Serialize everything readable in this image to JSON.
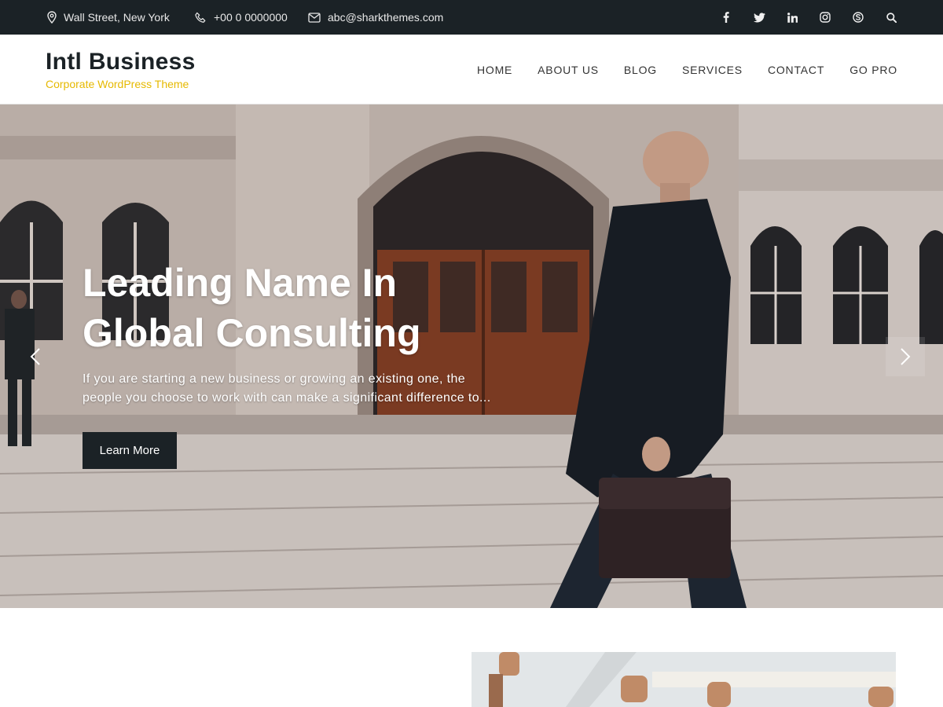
{
  "topbar": {
    "address": "Wall Street, New York",
    "phone": "+00 0 0000000",
    "email": "abc@sharkthemes.com",
    "social": [
      "facebook-icon",
      "twitter-icon",
      "linkedin-icon",
      "instagram-icon",
      "skype-icon",
      "search-icon"
    ]
  },
  "header": {
    "title": "Intl Business",
    "tagline": "Corporate WordPress Theme",
    "nav": [
      {
        "label": "HOME"
      },
      {
        "label": "ABOUT US"
      },
      {
        "label": "BLOG"
      },
      {
        "label": "SERVICES"
      },
      {
        "label": "CONTACT"
      },
      {
        "label": "GO PRO"
      }
    ]
  },
  "hero": {
    "title_line1": "Leading Name In",
    "title_line2": "Global Consulting",
    "text_line1": "If you are starting a new business or growing an existing one, the",
    "text_line2": "people you choose to work with can make a significant difference to...",
    "button": "Learn More"
  },
  "colors": {
    "dark": "#1b2226",
    "accent": "#e6b900",
    "white": "#ffffff"
  }
}
